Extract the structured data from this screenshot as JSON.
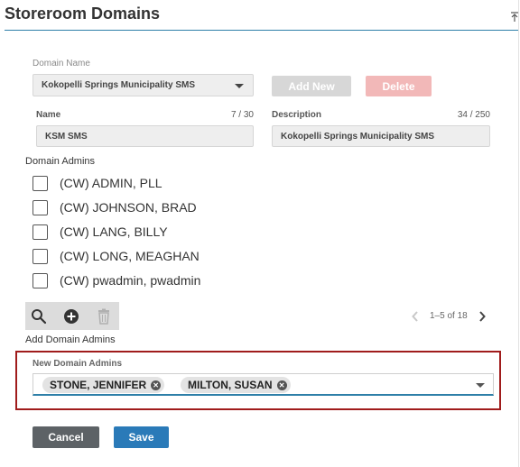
{
  "page": {
    "title": "Storeroom Domains",
    "collapse_icon": "collapse-up-icon"
  },
  "domain": {
    "label": "Domain Name",
    "selected": "Kokopelli Springs Municipality SMS",
    "add_new_label": "Add New",
    "delete_label": "Delete"
  },
  "name_field": {
    "label": "Name",
    "counter": "7 / 30",
    "value": "KSM SMS"
  },
  "description_field": {
    "label": "Description",
    "counter": "34 / 250",
    "value": "Kokopelli Springs Municipality SMS"
  },
  "domain_admins": {
    "label": "Domain Admins",
    "items": [
      {
        "name": "(CW) ADMIN, PLL",
        "checked": false
      },
      {
        "name": "(CW) JOHNSON, BRAD",
        "checked": false
      },
      {
        "name": "(CW) LANG, BILLY",
        "checked": false
      },
      {
        "name": "(CW) LONG, MEAGHAN",
        "checked": false
      },
      {
        "name": "(CW) pwadmin, pwadmin",
        "checked": false
      }
    ]
  },
  "toolbar": {
    "icons": [
      "search-icon",
      "add-circle-icon",
      "trash-icon"
    ]
  },
  "pagination": {
    "text": "1–5 of 18"
  },
  "add_domain_admins_label": "Add Domain Admins",
  "new_domain_admins": {
    "label": "New Domain Admins",
    "chips": [
      "STONE, JENNIFER",
      "MILTON, SUSAN"
    ]
  },
  "actions": {
    "cancel_label": "Cancel",
    "save_label": "Save"
  },
  "colors": {
    "accent": "#2e7fa8",
    "save": "#2a7ab8",
    "cancel": "#5d6266",
    "highlight_border": "#a01c1c",
    "delete_disabled": "#f2b8b8",
    "add_new_disabled": "#d7d7d7"
  }
}
